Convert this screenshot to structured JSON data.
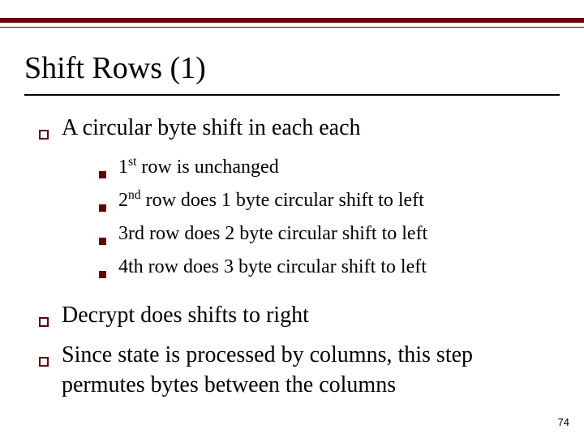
{
  "title": "Shift Rows (1)",
  "bullets": [
    {
      "text": "A circular byte shift in each each",
      "sub": [
        {
          "ordinal": "1",
          "sup": "st",
          "rest": " row is unchanged"
        },
        {
          "ordinal": "2",
          "sup": "nd",
          "rest": " row does 1 byte circular shift to left"
        },
        {
          "plain": "3rd row does 2 byte circular shift to left"
        },
        {
          "plain": "4th row does 3 byte circular shift to left"
        }
      ]
    },
    {
      "text": "Decrypt does shifts to right"
    },
    {
      "text": "Since state is processed by columns, this step permutes bytes between the columns"
    }
  ],
  "page_number": "74",
  "colors": {
    "accent": "#660000"
  }
}
